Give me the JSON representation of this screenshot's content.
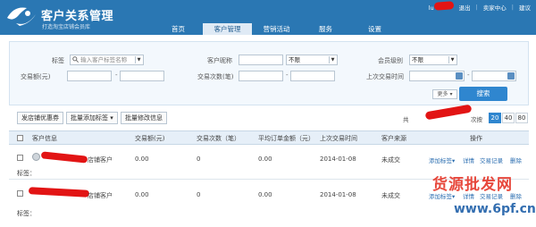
{
  "app": {
    "title": "客户关系管理",
    "subtitle": "打造淘宝店铺会员库"
  },
  "top_links": {
    "user_prefix": "lu",
    "logout": "退出",
    "seller_center": "卖家中心",
    "suggest": "建议"
  },
  "nav": {
    "items": [
      {
        "label": "首页"
      },
      {
        "label": "客户管理"
      },
      {
        "label": "营销活动"
      },
      {
        "label": "服务"
      },
      {
        "label": "设置"
      }
    ],
    "active_index": 1
  },
  "filter": {
    "tag_label": "标签",
    "tag_placeholder": "输入客户标签名称",
    "nickname_label": "客户昵称",
    "nickname_value": "",
    "unlimited_1": "不限",
    "member_level_label": "会员级别",
    "unlimited_2": "不限",
    "amount_label": "交易额(元)",
    "count_label": "交易次数(笔)",
    "last_time_label": "上次交易时间",
    "more_label": "更多",
    "search_label": "搜索"
  },
  "toolbar": {
    "coupon": "发店铺优惠券",
    "batch_tag": "批量添加标签",
    "batch_edit": "批量修改信息"
  },
  "pager": {
    "prefix": "共",
    "suffix": "次按",
    "sizes": [
      "20",
      "40",
      "80"
    ],
    "active_size": "20"
  },
  "table": {
    "headers": [
      "客户信息",
      "交易额(元)",
      "交易次数（笔）",
      "平均订单金额（元）",
      "上次交易时间",
      "客户来源",
      "操作"
    ],
    "rows": [
      {
        "name_suffix": "店铺客户",
        "amount": "0.00",
        "count": "0",
        "avg": "0.00",
        "last_time": "2014-01-08",
        "source": "未成交",
        "actions": [
          "添加标签",
          "详情",
          "交易记录",
          "删除"
        ],
        "tag_label": "标签："
      },
      {
        "name_suffix": "店铺客户",
        "amount": "0.00",
        "count": "0",
        "avg": "0.00",
        "last_time": "2014-01-08",
        "source": "未成交",
        "actions": [
          "添加标签",
          "详情",
          "交易记录",
          "删除"
        ],
        "tag_label": "标签："
      }
    ]
  },
  "watermark": {
    "line1": "货源批发网",
    "line2": "www.6pf.cn"
  }
}
